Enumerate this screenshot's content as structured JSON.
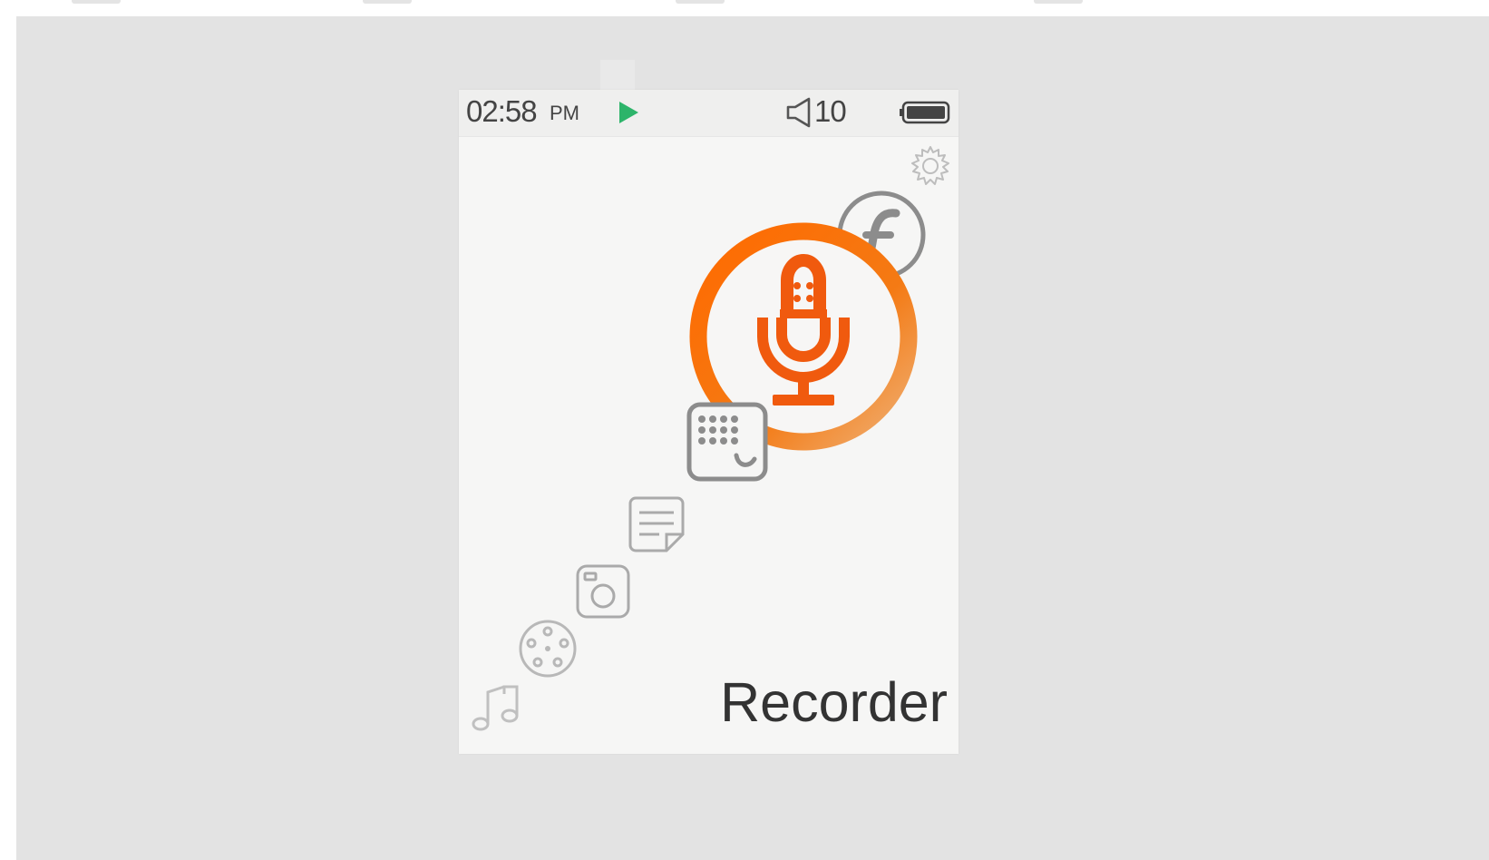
{
  "status_bar": {
    "time": "02:58",
    "ampm": "PM",
    "play_icon": "play-icon",
    "volume_icon": "speaker-icon",
    "volume_level": "10",
    "battery_icon": "battery-icon"
  },
  "settings": {
    "icon": "gear-icon"
  },
  "apps": [
    {
      "icon": "flash-icon"
    },
    {
      "icon": "microphone-icon",
      "selected": true
    },
    {
      "icon": "dialer-icon"
    },
    {
      "icon": "notes-icon"
    },
    {
      "icon": "camera-icon"
    },
    {
      "icon": "film-reel-icon"
    },
    {
      "icon": "music-note-icon"
    }
  ],
  "selected_app": {
    "label": "Recorder"
  },
  "colors": {
    "accent": "#f05a0e",
    "ring": "#f47a14",
    "play": "#2db46a",
    "inactive_icon": "#8c8c8c"
  }
}
